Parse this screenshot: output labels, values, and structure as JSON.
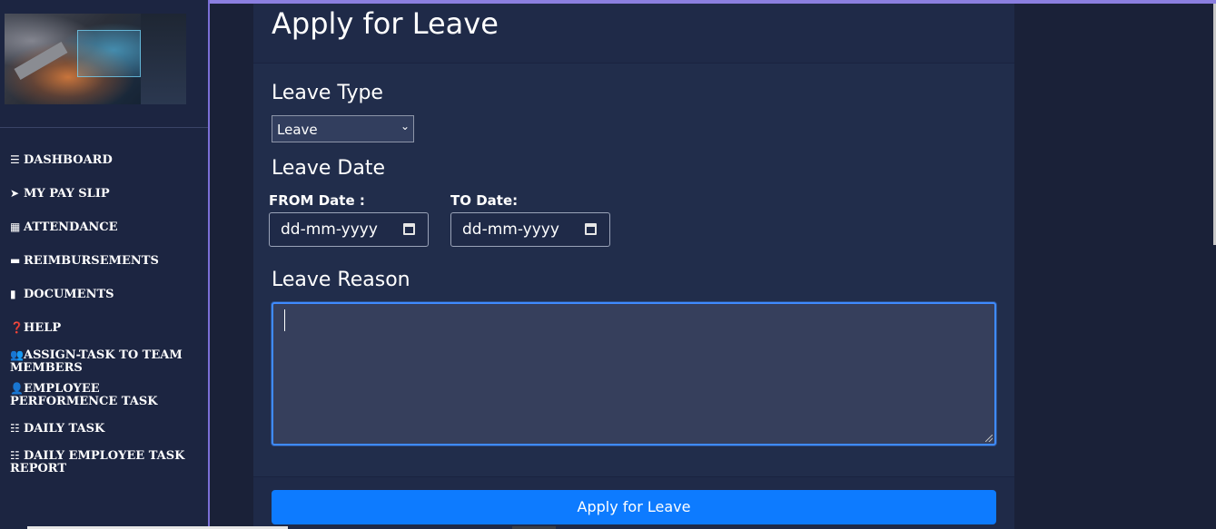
{
  "nav": {
    "items": [
      {
        "label": "DASHBOARD",
        "icon": "bars-icon",
        "glyph": "☰"
      },
      {
        "label": "MY PAY SLIP",
        "icon": "paper-plane-icon",
        "glyph": "➤"
      },
      {
        "label": "ATTENDANCE",
        "icon": "calendar-icon",
        "glyph": "▦"
      },
      {
        "label": "REIMBURSEMENTS",
        "icon": "credit-card-icon",
        "glyph": "▬"
      },
      {
        "label": "DOCUMENTS",
        "icon": "file-icon",
        "glyph": "▮"
      },
      {
        "label": "HELP",
        "icon": "question-circle-icon",
        "glyph": "❓"
      },
      {
        "label": "ASSIGN-TASK TO TEAM MEMBERS",
        "icon": "users-icon",
        "glyph": "👥"
      },
      {
        "label": "EMPLOYEE PERFORMENCE TASK",
        "icon": "user-edit-icon",
        "glyph": "👤"
      },
      {
        "label": "DAILY TASK",
        "icon": "tasks-icon",
        "glyph": "☷"
      },
      {
        "label": "DAILY EMPLOYEE TASK REPORT",
        "icon": "tasks-icon",
        "glyph": "☷"
      }
    ]
  },
  "page": {
    "title": "Apply for Leave"
  },
  "form": {
    "leave_type_title": "Leave Type",
    "leave_type_value": "Leave",
    "leave_date_title": "Leave Date",
    "from_label": "FROM Date :",
    "to_label": "TO Date:",
    "from_placeholder": "dd-mm-yyyy",
    "to_placeholder": "dd-mm-yyyy",
    "reason_title": "Leave Reason",
    "reason_value": "",
    "submit_label": "Apply for Leave"
  },
  "colors": {
    "background": "#1a2138",
    "card": "#1f2a48",
    "primary_button": "#0d7bff",
    "sidebar_border": "#7b6fd6"
  }
}
